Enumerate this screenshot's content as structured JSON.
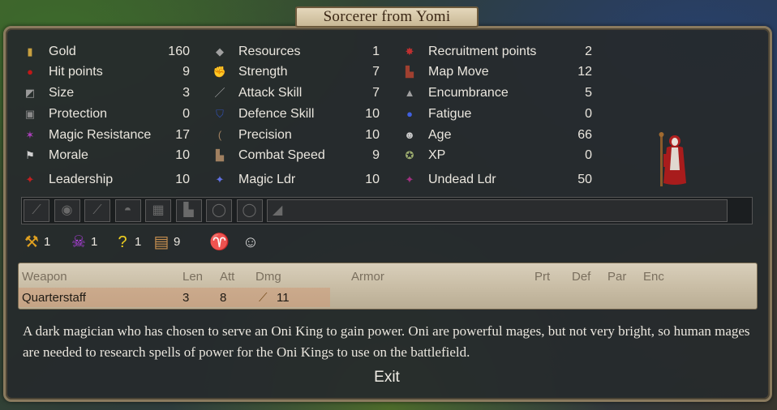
{
  "title": "Sorcerer from Yomi",
  "stats_col1": [
    {
      "label": "Gold",
      "value": "160",
      "icon": "gold-icon",
      "glyph": "▮",
      "color": "#c8a040"
    },
    {
      "label": "Hit points",
      "value": "9",
      "icon": "blood-drop-icon",
      "glyph": "●",
      "color": "#c01818"
    },
    {
      "label": "Size",
      "value": "3",
      "icon": "size-icon",
      "glyph": "◩",
      "color": "#9a9a9a"
    },
    {
      "label": "Protection",
      "value": "0",
      "icon": "armor-icon",
      "glyph": "▣",
      "color": "#8a8a8a"
    },
    {
      "label": "Magic Resistance",
      "value": "17",
      "icon": "magic-resistance-icon",
      "glyph": "✶",
      "color": "#b040c0"
    },
    {
      "label": "Morale",
      "value": "10",
      "icon": "flag-icon",
      "glyph": "⚑",
      "color": "#d0d0d0"
    },
    {
      "label": "Leadership",
      "value": "10",
      "icon": "leadership-icon",
      "glyph": "✦",
      "color": "#c02020"
    }
  ],
  "stats_col2": [
    {
      "label": "Resources",
      "value": "1",
      "icon": "resources-icon",
      "glyph": "◆",
      "color": "#a0a0a0"
    },
    {
      "label": "Strength",
      "value": "7",
      "icon": "strength-arm-icon",
      "glyph": "✊",
      "color": "#d08060"
    },
    {
      "label": "Attack Skill",
      "value": "7",
      "icon": "sword-icon",
      "glyph": "／",
      "color": "#b0b0b0"
    },
    {
      "label": "Defence Skill",
      "value": "10",
      "icon": "shield-icon",
      "glyph": "⛉",
      "color": "#3050b0"
    },
    {
      "label": "Precision",
      "value": "10",
      "icon": "bow-icon",
      "glyph": "(",
      "color": "#a08060"
    },
    {
      "label": "Combat Speed",
      "value": "9",
      "icon": "boot-icon",
      "glyph": "▙",
      "color": "#a08060"
    },
    {
      "label": "Magic Ldr",
      "value": "10",
      "icon": "magic-leader-icon",
      "glyph": "✦",
      "color": "#6070e0"
    }
  ],
  "stats_col3": [
    {
      "label": "Recruitment points",
      "value": "2",
      "icon": "recruitment-icon",
      "glyph": "✸",
      "color": "#c03030"
    },
    {
      "label": "Map Move",
      "value": "12",
      "icon": "map-move-boot-icon",
      "glyph": "▙",
      "color": "#a04030"
    },
    {
      "label": "Encumbrance",
      "value": "5",
      "icon": "weight-icon",
      "glyph": "▲",
      "color": "#a0a0a0"
    },
    {
      "label": "Fatigue",
      "value": "0",
      "icon": "sweat-drop-icon",
      "glyph": "●",
      "color": "#4060e0"
    },
    {
      "label": "Age",
      "value": "66",
      "icon": "skull-age-icon",
      "glyph": "☻",
      "color": "#c8c8c8"
    },
    {
      "label": "XP",
      "value": "0",
      "icon": "xp-star-icon",
      "glyph": "✪",
      "color": "#a0b070"
    },
    {
      "label": "Undead Ldr",
      "value": "50",
      "icon": "undead-leader-icon",
      "glyph": "✦",
      "color": "#a03080"
    }
  ],
  "equipment_slots": [
    {
      "icon": "weapon-slot-icon",
      "glyph": "⟋"
    },
    {
      "icon": "shield-slot-icon",
      "glyph": "◉"
    },
    {
      "icon": "weapon2-slot-icon",
      "glyph": "⟋"
    },
    {
      "icon": "helmet-slot-icon",
      "glyph": "◓"
    },
    {
      "icon": "body-armor-slot-icon",
      "glyph": "▦"
    },
    {
      "icon": "boots-slot-icon",
      "glyph": "▙"
    },
    {
      "icon": "ring-slot-icon",
      "glyph": "◯"
    },
    {
      "icon": "ring2-slot-icon",
      "glyph": "◯"
    },
    {
      "icon": "misc-slot-icon",
      "glyph": "◢"
    }
  ],
  "badges": [
    {
      "icon": "hammer-icon",
      "glyph": "⚒",
      "color": "#e0a020",
      "value": "1"
    },
    {
      "icon": "skull-death-magic-icon",
      "glyph": "☠",
      "color": "#b040e0",
      "value": "1"
    },
    {
      "icon": "question-random-icon",
      "glyph": "?",
      "color": "#f0d020",
      "value": "1"
    },
    {
      "icon": "research-books-icon",
      "glyph": "▤",
      "color": "#c89050",
      "value": "9"
    },
    {
      "icon": "goat-icon",
      "glyph": "♈",
      "color": "#d8d0c0",
      "value": ""
    },
    {
      "icon": "old-face-icon",
      "glyph": "☺",
      "color": "#d8d8d8",
      "value": ""
    }
  ],
  "weapon_table": {
    "headers": {
      "weapon": "Weapon",
      "len": "Len",
      "att": "Att",
      "dmg": "Dmg",
      "armor": "Armor",
      "prt": "Prt",
      "def": "Def",
      "par": "Par",
      "enc": "Enc"
    },
    "rows": [
      {
        "weapon": "Quarterstaff",
        "len": "3",
        "att": "8",
        "dmg": "11"
      }
    ]
  },
  "description": "A dark magician who has chosen to serve an Oni King to gain power. Oni are powerful mages, but not very bright, so human mages are needed to research spells of power for the Oni Kings to use on the battlefield.",
  "exit_label": "Exit"
}
